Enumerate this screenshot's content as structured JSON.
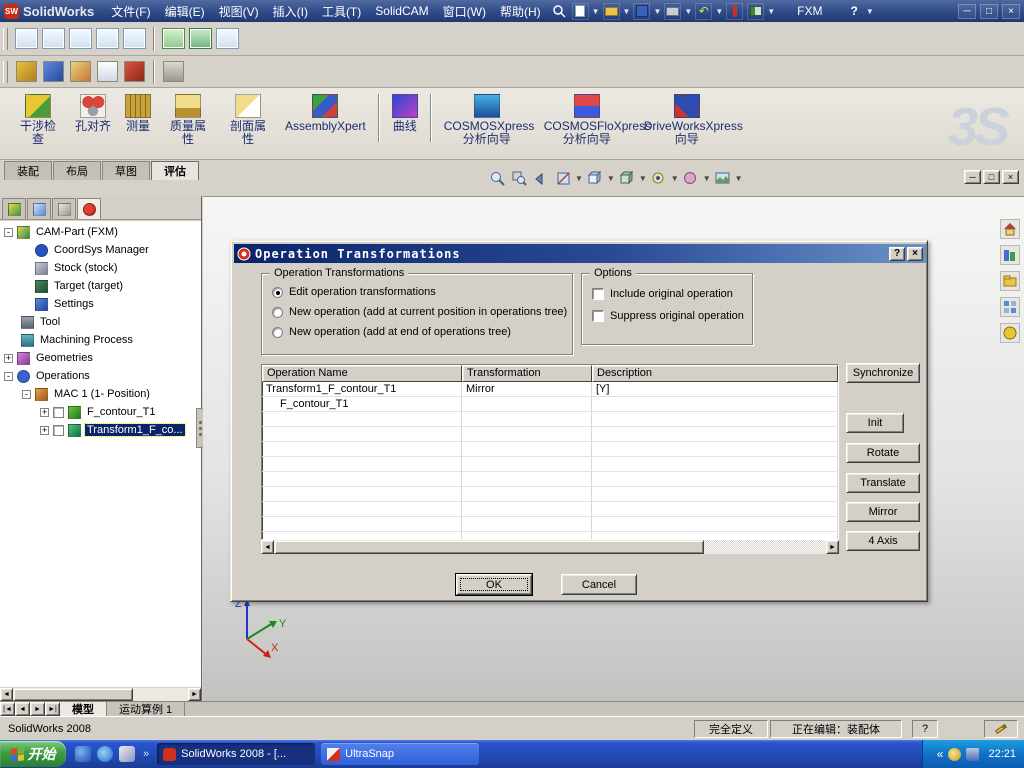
{
  "titlebar": {
    "logo": "SolidWorks",
    "menus": [
      "文件(F)",
      "编辑(E)",
      "视图(V)",
      "插入(I)",
      "工具(T)",
      "SolidCAM",
      "窗口(W)",
      "帮助(H)"
    ],
    "doc": "FXM",
    "help": "?",
    "minimize": "─",
    "maximize": "□",
    "close": "×"
  },
  "commandbar": {
    "items": [
      "干涉检查",
      "孔对齐",
      "测量",
      "质量属性",
      "剖面属性",
      "AssemblyXpert",
      "曲线",
      "COSMOSXpress 分析向导",
      "COSMOSFloXpress 分析向导",
      "DriveWorksXpress 向导"
    ]
  },
  "cm_tabs": [
    "装配",
    "布局",
    "草图",
    "评估"
  ],
  "ds_logo": "3S",
  "tree": {
    "items": [
      "CAM-Part (FXM)",
      "CoordSys Manager",
      "Stock (stock)",
      "Target (target)",
      "Settings",
      "Tool",
      "Machining Process",
      "Geometries",
      "Operations",
      "MAC 1 (1- Position)",
      "F_contour_T1",
      "Transform1_F_co..."
    ]
  },
  "dialog": {
    "title": "Operation Transformations",
    "help": "?",
    "close": "×",
    "group_transform": {
      "title": "Operation Transformations",
      "radio1": "Edit operation transformations",
      "radio2": "New operation (add at current position in operations tree)",
      "radio3": "New operation (add at end of operations tree)"
    },
    "group_options": {
      "title": "Options",
      "check1": "Include original operation",
      "check2": "Suppress original operation"
    },
    "table": {
      "col1": "Operation Name",
      "col2": "Transformation",
      "col3": "Description",
      "rows": [
        {
          "name": "Transform1_F_contour_T1",
          "transform": "Mirror",
          "desc": "[Y]"
        },
        {
          "name": "F_contour_T1",
          "transform": "",
          "desc": ""
        }
      ]
    },
    "buttons": {
      "synchronize": "Synchronize",
      "init": "Init",
      "rotate": "Rotate",
      "translate": "Translate",
      "mirror": "Mirror",
      "axis4": "4 Axis",
      "ok": "OK",
      "cancel": "Cancel"
    }
  },
  "triad": {
    "x": "X",
    "y": "Y",
    "z": "Z"
  },
  "model_tabs": [
    "模型",
    "运动算例 1"
  ],
  "statusbar": {
    "app": "SolidWorks 2008",
    "define": "完全定义",
    "editing": "正在编辑：装配体",
    "help": "?"
  },
  "taskbar": {
    "start": "开始",
    "task1": "SolidWorks 2008 - [...",
    "task2": "UltraSnap",
    "time": "22:21"
  }
}
